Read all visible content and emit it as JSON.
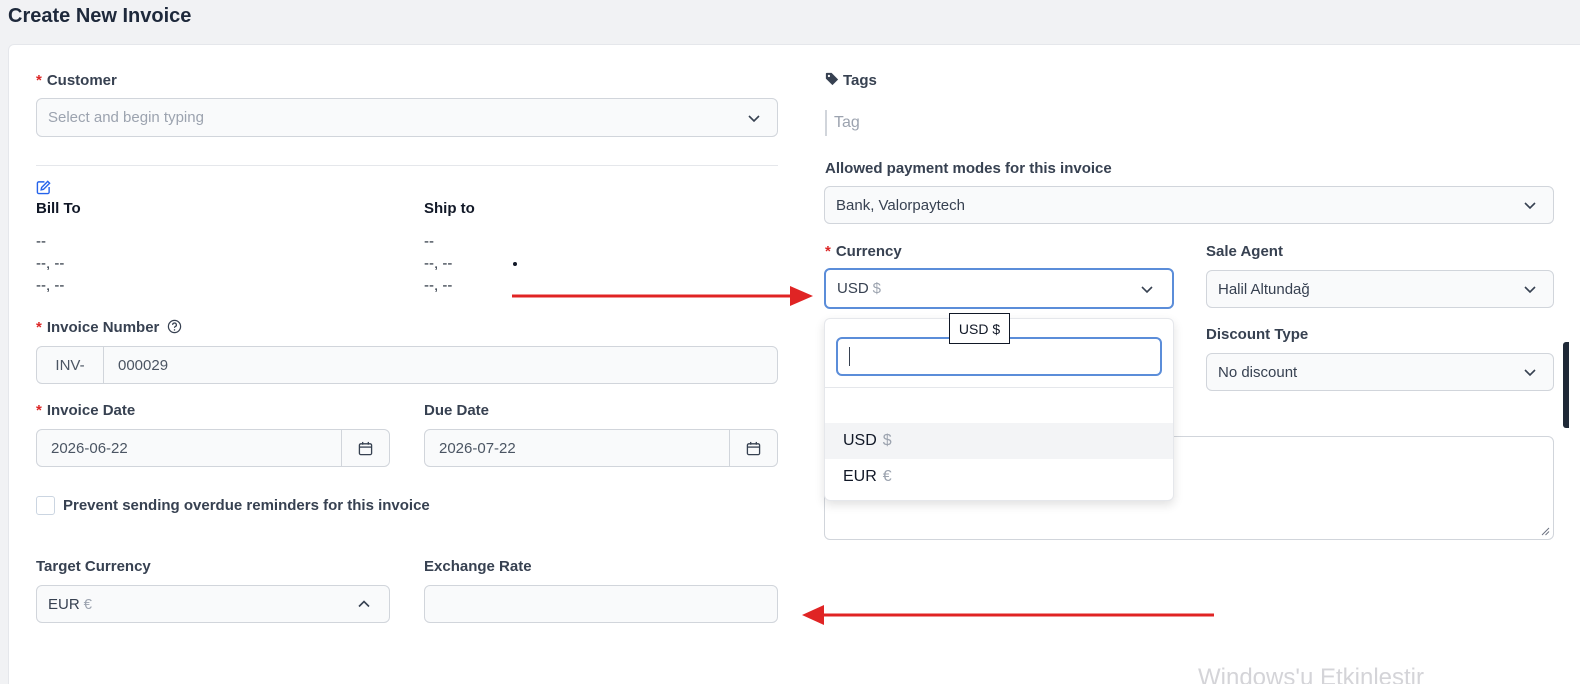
{
  "page": {
    "title": "Create New Invoice"
  },
  "customer": {
    "label": "Customer",
    "placeholder": "Select and begin typing"
  },
  "bill_to": {
    "label": "Bill To",
    "lines": [
      "--",
      "--, --",
      "--, --"
    ]
  },
  "ship_to": {
    "label": "Ship to",
    "lines": [
      "--",
      "--, --",
      "--, --"
    ]
  },
  "invoice_number": {
    "label": "Invoice Number",
    "prefix": "INV-",
    "value": "000029"
  },
  "invoice_date": {
    "label": "Invoice Date",
    "value": "2026-06-22"
  },
  "due_date": {
    "label": "Due Date",
    "value": "2026-07-22"
  },
  "overdue_reminder": {
    "label": "Prevent sending overdue reminders for this invoice"
  },
  "target_currency": {
    "label": "Target Currency",
    "code": "EUR",
    "symbol": "€"
  },
  "exchange_rate": {
    "label": "Exchange Rate",
    "value": ""
  },
  "tags": {
    "label": "Tags",
    "placeholder": "Tag"
  },
  "payment_modes": {
    "label": "Allowed payment modes for this invoice",
    "value": "Bank, Valorpaytech"
  },
  "currency": {
    "label": "Currency",
    "code": "USD",
    "symbol": "$",
    "tooltip": "USD $",
    "search_value": "",
    "options": [
      {
        "code": "USD",
        "symbol": "$"
      },
      {
        "code": "EUR",
        "symbol": "€"
      }
    ]
  },
  "sale_agent": {
    "label": "Sale Agent",
    "value": "Halil Altundağ"
  },
  "discount_type": {
    "label": "Discount Type",
    "value": "No discount"
  },
  "watermark": "Windows'u Etkinleştir",
  "colors": {
    "accent": "#5b8dd9",
    "required": "#dc2626",
    "arrow": "#e02424"
  }
}
